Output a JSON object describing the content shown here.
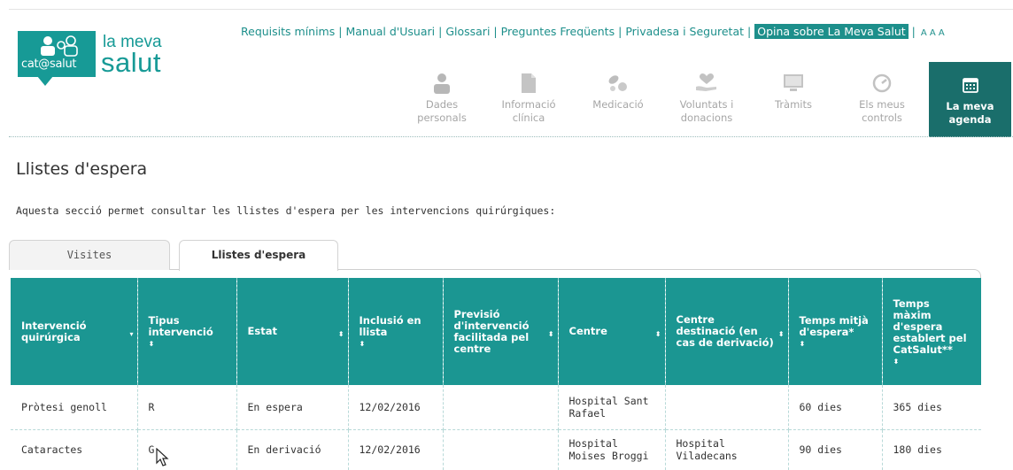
{
  "logo": {
    "badge_text": "cat@salut",
    "line1": "la meva",
    "line2": "salut",
    "color": "#179a96"
  },
  "top_links": {
    "items": [
      "Requisits mínims",
      "Manual d'Usuari",
      "Glossari",
      "Preguntes Freqüents",
      "Privadesa i Seguretat"
    ],
    "highlight": "Opina sobre La Meva Salut",
    "font_sizes": "A A A"
  },
  "nav": {
    "items": [
      {
        "line1": "Dades",
        "line2": "personals",
        "icon": "person-icon"
      },
      {
        "line1": "Informació",
        "line2": "clínica",
        "icon": "document-icon"
      },
      {
        "line1": "Medicació",
        "line2": "",
        "icon": "pills-icon"
      },
      {
        "line1": "Voluntats i",
        "line2": "donacions",
        "icon": "hand-heart-icon"
      },
      {
        "line1": "Tràmits",
        "line2": "",
        "icon": "monitor-icon"
      },
      {
        "line1": "Els meus",
        "line2": "controls",
        "icon": "gauge-icon"
      }
    ],
    "active": {
      "line1": "La meva",
      "line2": "agenda",
      "icon": "calendar-icon"
    },
    "active_color": "#1a6e6b"
  },
  "page": {
    "title": "Llistes d'espera",
    "intro": "Aquesta secció permet consultar les llistes d'espera per les intervencions quirúrgiques:"
  },
  "tabs": {
    "visites": "Visites",
    "llistes": "Llistes d'espera"
  },
  "table": {
    "header_color": "#1b9692",
    "columns": [
      "Intervenció quirúrgica",
      "Tipus intervenció",
      "Estat",
      "Inclusió en llista",
      "Previsió d'intervenció facilitada pel centre",
      "Centre",
      "Centre destinació (en cas de derivació)",
      "Temps mitjà d'espera*",
      "Temps màxim d'espera establert pel CatSalut**"
    ],
    "rows": [
      [
        "Pròtesi genoll",
        "R",
        "En espera",
        "12/02/2016",
        "",
        "Hospital Sant Rafael",
        "",
        "60 dies",
        "365 dies"
      ],
      [
        "Cataractes",
        "G",
        "En derivació",
        "12/02/2016",
        "",
        "Hospital Moises Broggi",
        "Hospital Viladecans",
        "90 dies",
        "180 dies"
      ]
    ]
  }
}
